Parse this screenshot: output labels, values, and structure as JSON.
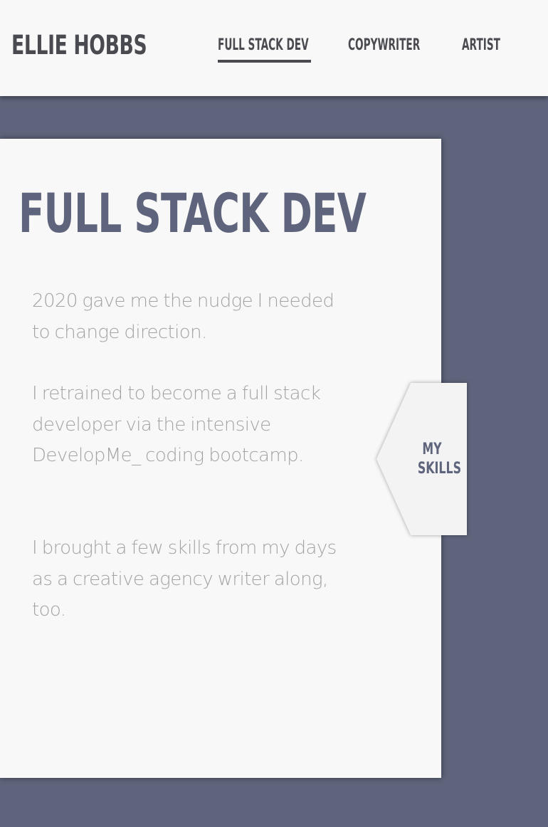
{
  "header": {
    "logo": "ELLIE HOBBS",
    "nav": [
      {
        "label": "FULL STACK DEV",
        "active": true
      },
      {
        "label": "COPYWRITER",
        "active": false
      },
      {
        "label": "ARTIST",
        "active": false
      }
    ]
  },
  "main": {
    "title": "FULL STACK DEV",
    "paragraphs": [
      "2020 gave me the nudge I needed to change direction.",
      "I retrained to become a full stack developer via the intensive DevelopMe_ coding bootcamp.",
      "I brought a few skills from my days as a creative agency writer along, too."
    ],
    "skills_tab": {
      "label": "MY\nSKILLS"
    }
  },
  "colors": {
    "accent": "#5e647b",
    "background": "#f8f8f8",
    "text_dark": "#4a4b50",
    "text_light": "#a3a3a6"
  }
}
